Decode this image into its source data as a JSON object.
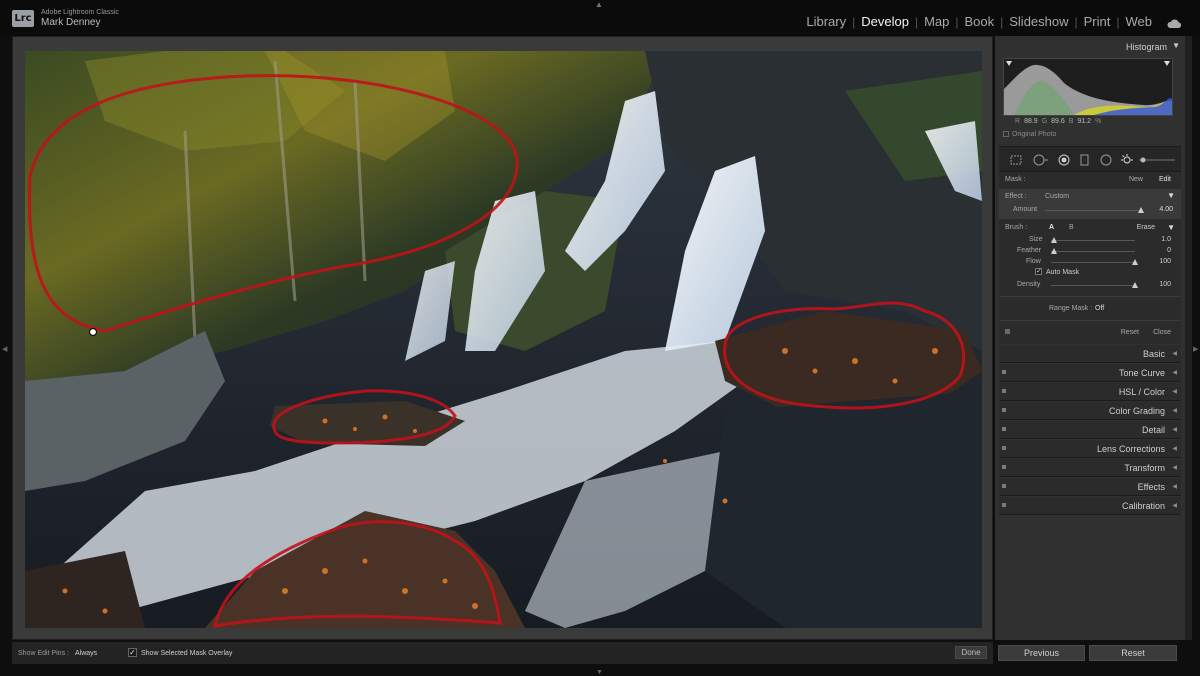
{
  "app": {
    "logo": "Lrc",
    "name": "Adobe Lightroom Classic",
    "user": "Mark Denney"
  },
  "modules": [
    "Library",
    "Develop",
    "Map",
    "Book",
    "Slideshow",
    "Print",
    "Web"
  ],
  "active_module": "Develop",
  "histogram": {
    "title": "Histogram",
    "r_label": "R",
    "r_value": "88.9",
    "g_label": "G",
    "g_value": "89.6",
    "b_label": "B",
    "b_value": "91.2",
    "unit": "%",
    "original_photo": "Original Photo"
  },
  "mask": {
    "label": "Mask :",
    "new": "New",
    "edit": "Edit",
    "effect_label": "Effect :",
    "effect_value": "Custom",
    "amount_label": "Amount",
    "amount_value": "4.00",
    "brush_label": "Brush :",
    "brush_a": "A",
    "brush_b": "B",
    "brush_erase": "Erase",
    "size_label": "Size",
    "size_value": "1.0",
    "feather_label": "Feather",
    "feather_value": "0",
    "flow_label": "Flow",
    "flow_value": "100",
    "automask_label": "Auto Mask",
    "density_label": "Density",
    "density_value": "100",
    "range_mask_label": "Range Mask :",
    "range_mask_value": "Off",
    "reset": "Reset",
    "close": "Close"
  },
  "panels": [
    "Basic",
    "Tone Curve",
    "HSL / Color",
    "Color Grading",
    "Detail",
    "Lens Corrections",
    "Transform",
    "Effects",
    "Calibration"
  ],
  "toolbar": {
    "pins_label": "Show Edit Pins :",
    "pins_value": "Always",
    "overlay_label": "Show Selected Mask Overlay",
    "done": "Done"
  },
  "footer": {
    "previous": "Previous",
    "reset": "Reset"
  },
  "colors": {
    "mask_overlay": "#c0121a",
    "active_text": "#f2f2f2"
  }
}
